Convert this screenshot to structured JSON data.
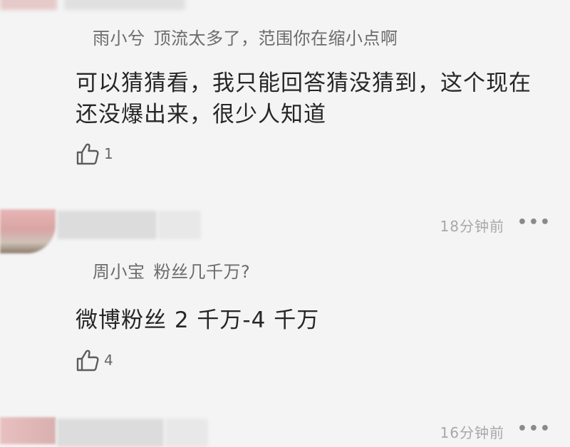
{
  "comments": [
    {
      "reply_to": "雨小兮",
      "reply_text": "顶流太多了，范围你在缩小点啊",
      "text": "可以猜猜看，我只能回答猜没猜到，这个现在还没爆出来，很少人知道",
      "likes": "1"
    },
    {
      "time": "18分钟前",
      "reply_to": "周小宝",
      "reply_text": "粉丝几千万?",
      "text": "微博粉丝 2 千万-4 千万",
      "likes": "4"
    },
    {
      "time": "16分钟前"
    }
  ],
  "icons": {
    "like": "thumbs-up-icon",
    "more": "more-dots-icon"
  },
  "more_label": "•••",
  "colors": {
    "background": "#f4f4f4",
    "text": "#262626",
    "secondary_text": "#6b6b6b",
    "time_text": "#a8a8a8"
  }
}
